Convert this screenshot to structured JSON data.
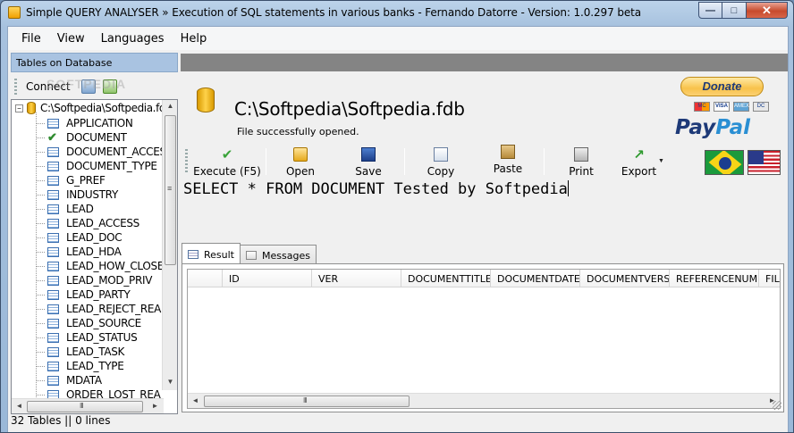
{
  "window": {
    "title": "Simple QUERY ANALYSER » Execution of SQL statements in various banks - Fernando Datorre - Version: 1.0.297 beta",
    "controls": {
      "minimize": "—",
      "maximize": "□",
      "close": "✕"
    }
  },
  "menu": [
    "File",
    "View",
    "Languages",
    "Help"
  ],
  "left_panel": {
    "header": "Tables on Database",
    "connect_label": "Connect",
    "watermark": "SOFTPEDIA",
    "root": "C:\\Softpedia\\Softpedia.fdb",
    "tables": [
      {
        "name": "APPLICATION",
        "icon": "table-icon"
      },
      {
        "name": "DOCUMENT",
        "icon": "check-icon"
      },
      {
        "name": "DOCUMENT_ACCES",
        "icon": "table-icon"
      },
      {
        "name": "DOCUMENT_TYPE",
        "icon": "table-icon"
      },
      {
        "name": "G_PREF",
        "icon": "table-icon"
      },
      {
        "name": "INDUSTRY",
        "icon": "table-icon"
      },
      {
        "name": "LEAD",
        "icon": "table-icon"
      },
      {
        "name": "LEAD_ACCESS",
        "icon": "table-icon"
      },
      {
        "name": "LEAD_DOC",
        "icon": "table-icon"
      },
      {
        "name": "LEAD_HDA",
        "icon": "table-icon"
      },
      {
        "name": "LEAD_HOW_CLOSE",
        "icon": "table-icon"
      },
      {
        "name": "LEAD_MOD_PRIV",
        "icon": "table-icon"
      },
      {
        "name": "LEAD_PARTY",
        "icon": "table-icon"
      },
      {
        "name": "LEAD_REJECT_REA",
        "icon": "table-icon"
      },
      {
        "name": "LEAD_SOURCE",
        "icon": "table-icon"
      },
      {
        "name": "LEAD_STATUS",
        "icon": "table-icon"
      },
      {
        "name": "LEAD_TASK",
        "icon": "table-icon"
      },
      {
        "name": "LEAD_TYPE",
        "icon": "table-icon"
      },
      {
        "name": "MDATA",
        "icon": "table-icon"
      },
      {
        "name": "ORDER_LOST_REA",
        "icon": "table-icon"
      }
    ],
    "scroll_grip": "≡",
    "hscroll_grip": "III"
  },
  "status_bar": "32 Tables || 0 lines",
  "database": {
    "path": "C:\\Softpedia\\Softpedia.fdb",
    "status": "File successfully opened."
  },
  "donate": {
    "button": "Donate",
    "cards": [
      "MC",
      "VISA",
      "AMEX",
      "DC"
    ],
    "paypal_pay": "Pay",
    "paypal_pal": "Pal"
  },
  "toolbar": {
    "execute": "Execute (F5)",
    "open": "Open",
    "save": "Save",
    "copy": "Copy",
    "paste": "Paste",
    "print": "Print",
    "export": "Export",
    "dropdown": "▼"
  },
  "sql": "SELECT * FROM DOCUMENT Tested by Softpedia",
  "results": {
    "tabs": [
      "Result",
      "Messages"
    ],
    "columns": [
      "ID",
      "VER",
      "DOCUMENTTITLE",
      "DOCUMENTDATE",
      "DOCUMENTVERS",
      "REFERENCENUM",
      "FIL"
    ],
    "hscroll_grip": "III"
  },
  "arrows": {
    "up": "▲",
    "down": "▼",
    "left": "◄",
    "right": "►"
  }
}
